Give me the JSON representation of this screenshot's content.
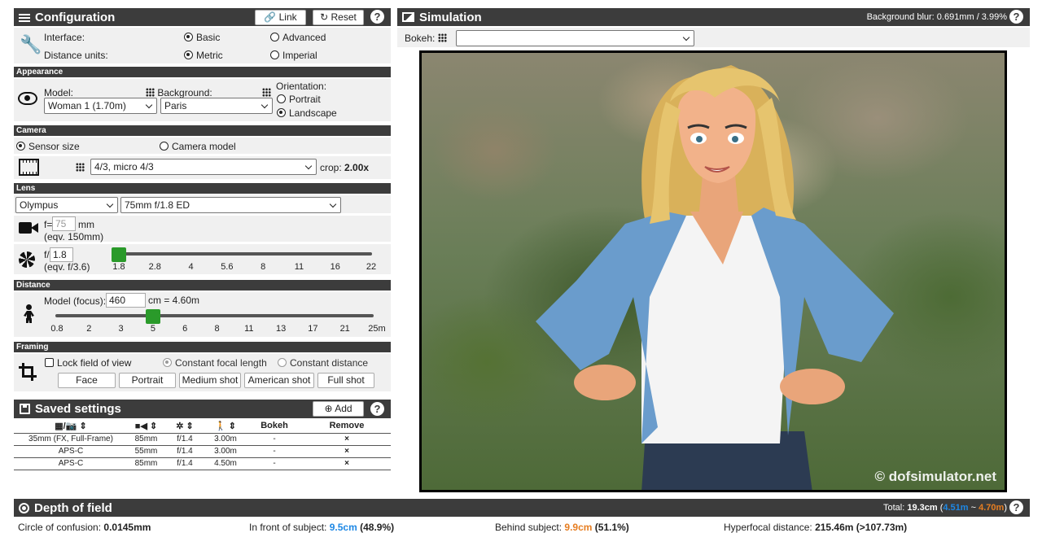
{
  "config": {
    "title": "Configuration",
    "link": "Link",
    "reset": "Reset",
    "help": "?",
    "interface_label": "Interface:",
    "basic": "Basic",
    "advanced": "Advanced",
    "units_label": "Distance units:",
    "metric": "Metric",
    "imperial": "Imperial"
  },
  "appearance": {
    "title": "Appearance",
    "model_label": "Model:",
    "model_value": "Woman 1 (1.70m)",
    "background_label": "Background:",
    "background_value": "Paris",
    "orientation_label": "Orientation:",
    "portrait": "Portrait",
    "landscape": "Landscape"
  },
  "camera": {
    "title": "Camera",
    "sensor_size": "Sensor size",
    "camera_model": "Camera model",
    "sensor_value": "4/3, micro 4/3",
    "crop_label": "crop:",
    "crop_value": "2.00x"
  },
  "lens": {
    "title": "Lens",
    "brand": "Olympus",
    "lens_value": "75mm f/1.8 ED",
    "f_prefix": "f=",
    "focal": "75",
    "mm": "mm",
    "eqv_focal": "(eqv. 150mm)",
    "ap_prefix": "f/",
    "aperture": "1.8",
    "eqv_aperture": "(eqv. f/3.6)",
    "aperture_ticks": [
      "1.8",
      "2.8",
      "4",
      "5.6",
      "8",
      "11",
      "16",
      "22"
    ],
    "aperture_level": 0.0
  },
  "distance": {
    "title": "Distance",
    "focus_label": "Model (focus):",
    "focus_value": "460",
    "focus_text": "cm = 4.60m",
    "ticks": [
      "0.8",
      "2",
      "3",
      "5",
      "6",
      "8",
      "11",
      "13",
      "17",
      "21",
      "25m"
    ],
    "level": 0.3
  },
  "framing": {
    "title": "Framing",
    "lock": "Lock field of view",
    "const_focal": "Constant focal length",
    "const_dist": "Constant distance",
    "buttons": [
      "Face",
      "Portrait",
      "Medium shot",
      "American shot",
      "Full shot"
    ]
  },
  "saved": {
    "title": "Saved settings",
    "add": "Add",
    "help": "?",
    "headers": {
      "bokeh": "Bokeh",
      "remove": "Remove"
    },
    "rows": [
      {
        "sensor": "35mm (FX, Full-Frame)",
        "focal": "85mm",
        "aperture": "f/1.4",
        "distance": "3.00m",
        "bokeh": "-",
        "remove": "×"
      },
      {
        "sensor": "APS-C",
        "focal": "55mm",
        "aperture": "f/1.4",
        "distance": "3.00m",
        "bokeh": "-",
        "remove": "×"
      },
      {
        "sensor": "APS-C",
        "focal": "85mm",
        "aperture": "f/1.4",
        "distance": "4.50m",
        "bokeh": "-",
        "remove": "×"
      }
    ]
  },
  "simulation": {
    "title": "Simulation",
    "blur": "Background blur: 0.691mm / 3.99%",
    "help": "?",
    "bokeh_label": "Bokeh:",
    "bokeh_value": "",
    "watermark": "© dofsimulator.net"
  },
  "dof": {
    "title": "Depth of field",
    "total_label": "Total:",
    "total": "19.3cm",
    "open": "(",
    "front_val": "4.51m",
    "tilde": " ~ ",
    "back_val": "4.70m",
    "close": ")",
    "help": "?",
    "coc_label": "Circle of confusion:",
    "coc": "0.0145mm",
    "front_label": "In front of subject:",
    "front": "9.5cm",
    "front_pct": "(48.9%)",
    "behind_label": "Behind subject:",
    "behind": "9.9cm",
    "behind_pct": "(51.1%)",
    "hyper_label": "Hyperfocal distance:",
    "hyper": "215.46m",
    "hyper_extra": "(>107.73m)"
  },
  "colors": {
    "bar": "#3c3c3c",
    "panel": "#f0f0f0",
    "slider": "#2a9a2a",
    "front": "#1e88e5",
    "back": "#e67e22"
  }
}
